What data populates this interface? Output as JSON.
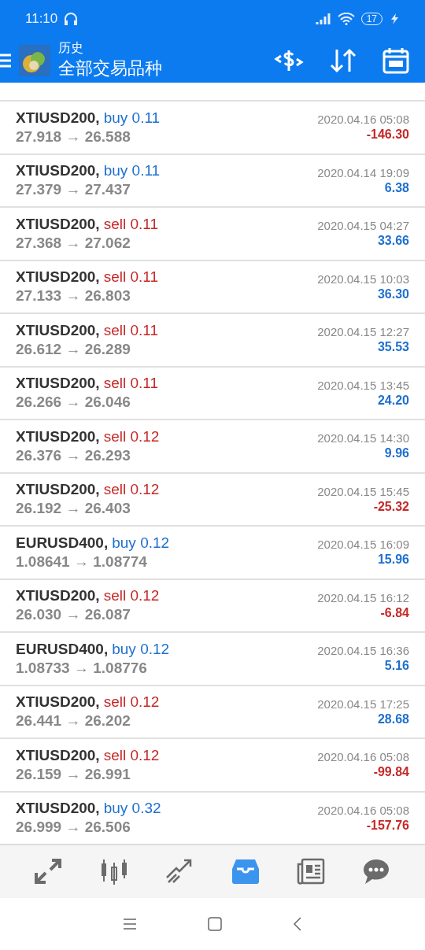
{
  "status_bar": {
    "time": "11:10",
    "battery": "17"
  },
  "header": {
    "subtitle": "历史",
    "title": "全部交易品种"
  },
  "deals": [
    {
      "symbol": "XTIUSD200,",
      "kind": "buy",
      "side": "buy",
      "volume": "0.11",
      "prices": "27.918 → 26.588",
      "time": "2020.04.16 05:08",
      "profit": "-146.30",
      "loss": true
    },
    {
      "symbol": "XTIUSD200,",
      "kind": "buy",
      "side": "buy",
      "volume": "0.11",
      "prices": "27.379 → 27.437",
      "time": "2020.04.14 19:09",
      "profit": "6.38",
      "loss": false
    },
    {
      "symbol": "XTIUSD200,",
      "kind": "sell",
      "side": "sell",
      "volume": "0.11",
      "prices": "27.368 → 27.062",
      "time": "2020.04.15 04:27",
      "profit": "33.66",
      "loss": false
    },
    {
      "symbol": "XTIUSD200,",
      "kind": "sell",
      "side": "sell",
      "volume": "0.11",
      "prices": "27.133 → 26.803",
      "time": "2020.04.15 10:03",
      "profit": "36.30",
      "loss": false
    },
    {
      "symbol": "XTIUSD200,",
      "kind": "sell",
      "side": "sell",
      "volume": "0.11",
      "prices": "26.612 → 26.289",
      "time": "2020.04.15 12:27",
      "profit": "35.53",
      "loss": false
    },
    {
      "symbol": "XTIUSD200,",
      "kind": "sell",
      "side": "sell",
      "volume": "0.11",
      "prices": "26.266 → 26.046",
      "time": "2020.04.15 13:45",
      "profit": "24.20",
      "loss": false
    },
    {
      "symbol": "XTIUSD200,",
      "kind": "sell",
      "side": "sell",
      "volume": "0.12",
      "prices": "26.376 → 26.293",
      "time": "2020.04.15 14:30",
      "profit": "9.96",
      "loss": false
    },
    {
      "symbol": "XTIUSD200,",
      "kind": "sell",
      "side": "sell",
      "volume": "0.12",
      "prices": "26.192 → 26.403",
      "time": "2020.04.15 15:45",
      "profit": "-25.32",
      "loss": true
    },
    {
      "symbol": "EURUSD400,",
      "kind": "buy",
      "side": "buy",
      "volume": "0.12",
      "prices": "1.08641 → 1.08774",
      "time": "2020.04.15 16:09",
      "profit": "15.96",
      "loss": false
    },
    {
      "symbol": "XTIUSD200,",
      "kind": "sell",
      "side": "sell",
      "volume": "0.12",
      "prices": "26.030 → 26.087",
      "time": "2020.04.15 16:12",
      "profit": "-6.84",
      "loss": true
    },
    {
      "symbol": "EURUSD400,",
      "kind": "buy",
      "side": "buy",
      "volume": "0.12",
      "prices": "1.08733 → 1.08776",
      "time": "2020.04.15 16:36",
      "profit": "5.16",
      "loss": false
    },
    {
      "symbol": "XTIUSD200,",
      "kind": "sell",
      "side": "sell",
      "volume": "0.12",
      "prices": "26.441 → 26.202",
      "time": "2020.04.15 17:25",
      "profit": "28.68",
      "loss": false
    },
    {
      "symbol": "XTIUSD200,",
      "kind": "sell",
      "side": "sell",
      "volume": "0.12",
      "prices": "26.159 → 26.991",
      "time": "2020.04.16 05:08",
      "profit": "-99.84",
      "loss": true
    },
    {
      "symbol": "XTIUSD200,",
      "kind": "buy",
      "side": "buy",
      "volume": "0.32",
      "prices": "26.999 → 26.506",
      "time": "2020.04.16 05:08",
      "profit": "-157.76",
      "loss": true
    }
  ],
  "bottom_nav": [
    {
      "kind": "quotes",
      "selected": false
    },
    {
      "kind": "chart",
      "selected": false
    },
    {
      "kind": "trade",
      "selected": false
    },
    {
      "kind": "history",
      "selected": true
    },
    {
      "kind": "news",
      "selected": false
    },
    {
      "kind": "chat",
      "selected": false
    }
  ]
}
